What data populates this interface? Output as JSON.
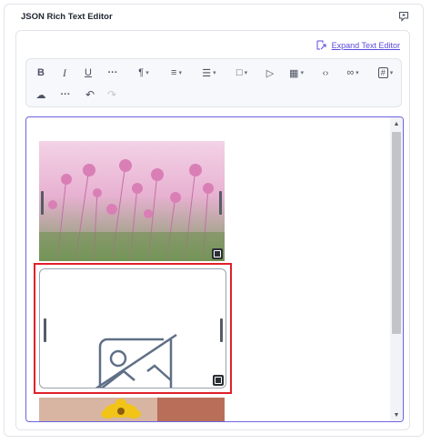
{
  "field": {
    "title": "JSON Rich Text Editor"
  },
  "expand": {
    "label": "Expand Text Editor"
  },
  "toolbar": {
    "row1": [
      {
        "name": "bold-button",
        "glyph": "B"
      },
      {
        "name": "italic-button",
        "glyph": "I"
      },
      {
        "name": "underline-button",
        "glyph": "U"
      },
      {
        "name": "more-formatting-button",
        "glyph": "···"
      },
      {
        "name": "paragraph-button",
        "glyph": "¶"
      },
      {
        "name": "align-button",
        "glyph": "≡"
      },
      {
        "name": "list-button",
        "glyph": "☰"
      },
      {
        "name": "page-button",
        "glyph": "□"
      },
      {
        "name": "video-button",
        "glyph": "▷"
      },
      {
        "name": "table-button",
        "glyph": "▦"
      },
      {
        "name": "code-button",
        "glyph": "‹›"
      },
      {
        "name": "link-button",
        "glyph": "∞"
      },
      {
        "name": "heading-button",
        "glyph": "#"
      }
    ],
    "row2": [
      {
        "name": "cloud-button",
        "glyph": "☁"
      },
      {
        "name": "more-options-button",
        "glyph": "···"
      },
      {
        "name": "undo-button",
        "glyph": "↶"
      },
      {
        "name": "redo-button",
        "glyph": "↷"
      }
    ]
  },
  "colors": {
    "accent": "#5b4ae0",
    "selection": "#e0202a",
    "editor_border": "#6c63e0"
  },
  "editor": {
    "images": [
      {
        "name": "pink-flower-field-image",
        "selected": false
      },
      {
        "name": "image-placeholder",
        "selected": true
      },
      {
        "name": "yellow-flower-image",
        "selected": false
      }
    ]
  }
}
